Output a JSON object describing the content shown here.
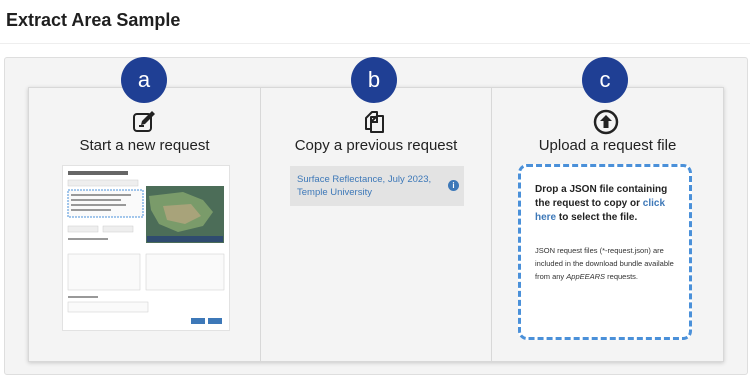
{
  "page": {
    "title": "Extract Area Sample"
  },
  "columns": [
    {
      "badge": "a",
      "icon": "edit-icon",
      "title": "Start a new request"
    },
    {
      "badge": "b",
      "icon": "copy-icon",
      "title": "Copy a previous request"
    },
    {
      "badge": "c",
      "icon": "upload-icon",
      "title": "Upload a request file"
    }
  ],
  "previous_request": {
    "label": "Surface Reflectance, July 2023, Temple University"
  },
  "upload": {
    "drop_text": "Drop a JSON file containing the request to copy or",
    "link_text": "click here",
    "after_link": "to select the file.",
    "note_prefix": "JSON request files (*-request.json) are included in the download bundle available from any",
    "note_app": "AppEEARS",
    "note_suffix": "requests."
  },
  "colors": {
    "badge": "#1f3f94",
    "link": "#3d78b8",
    "dashed_border": "#4a90d9"
  }
}
